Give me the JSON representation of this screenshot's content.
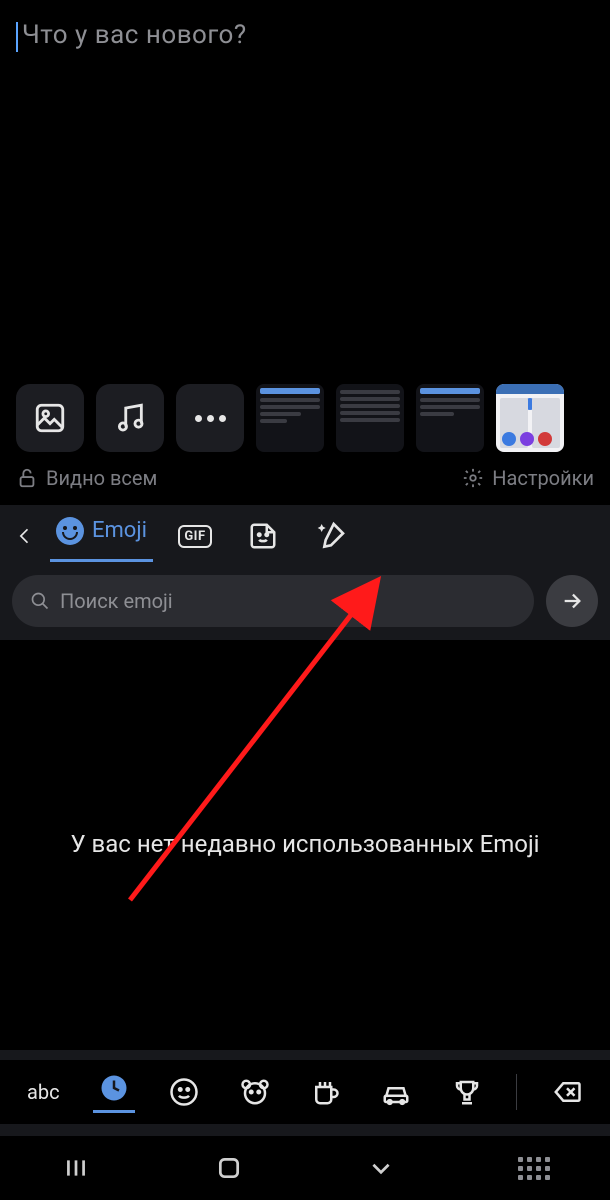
{
  "compose": {
    "placeholder": "Что у вас нового?"
  },
  "meta": {
    "privacy": "Видно всем",
    "settings": "Настройки"
  },
  "keyboard": {
    "tabs": {
      "emoji": "Emoji",
      "gif": "GIF"
    },
    "search_placeholder": "Поиск emoji",
    "empty_state": "У вас нет недавно использованных Emoji",
    "abc": "abc"
  }
}
